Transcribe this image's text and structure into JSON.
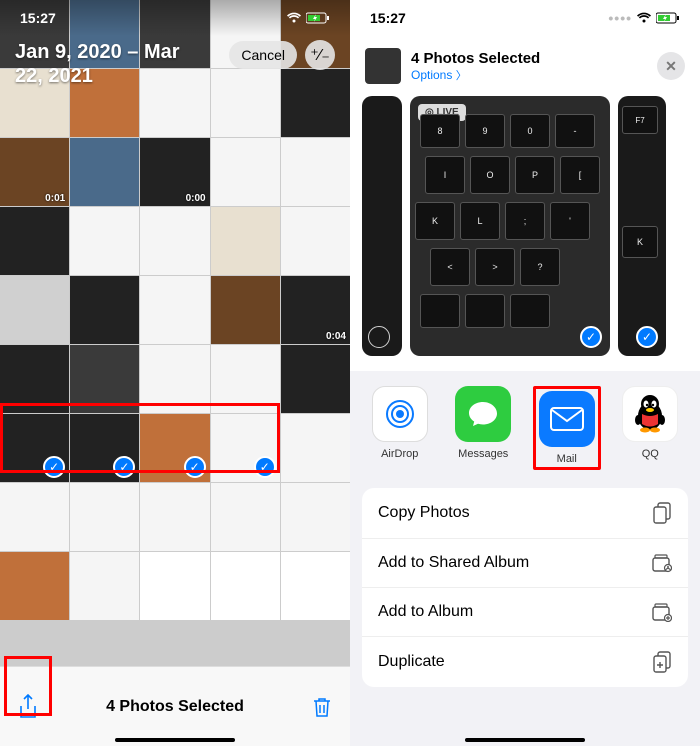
{
  "status": {
    "time": "15:27"
  },
  "left": {
    "date_range": "Jan 9, 2020 – Mar 22, 2021",
    "cancel": "Cancel",
    "durations": {
      "a": "0:01",
      "b": "0:00",
      "c": "0:04"
    },
    "selected_text": "4 Photos Selected"
  },
  "right": {
    "title": "4 Photos Selected",
    "options": "Options",
    "live_badge": "◎ LIVE",
    "apps": {
      "airdrop": "AirDrop",
      "messages": "Messages",
      "mail": "Mail",
      "qq": "QQ"
    },
    "actions": {
      "copy": "Copy Photos",
      "shared_album": "Add to Shared Album",
      "album": "Add to Album",
      "duplicate": "Duplicate"
    }
  }
}
